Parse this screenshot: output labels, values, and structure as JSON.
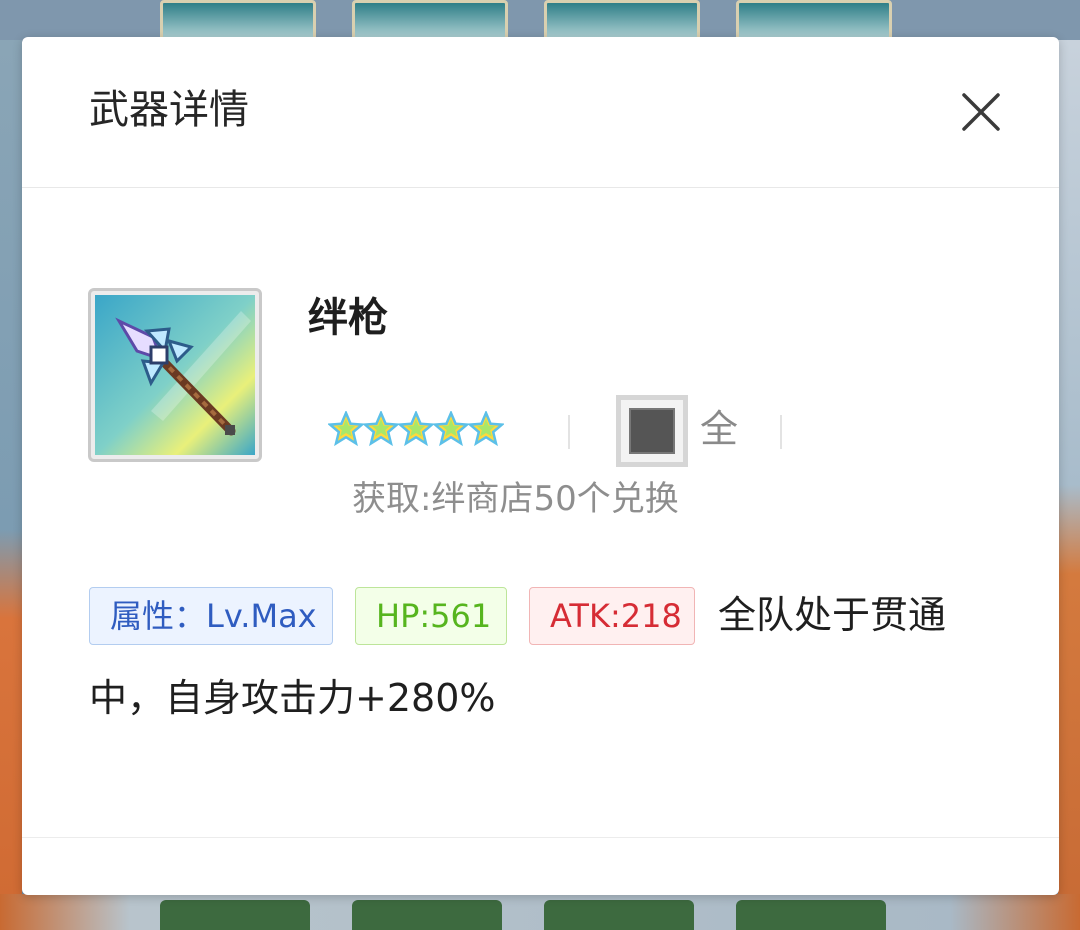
{
  "dialog": {
    "title": "武器详情",
    "close_icon": "close-icon"
  },
  "weapon": {
    "name": "绊枪",
    "icon": "spear-icon",
    "rarity_stars": 5,
    "element_label": "全",
    "source": "获取:绊商店50个兑换"
  },
  "tags": {
    "attribute": "属性：Lv.Max",
    "hp": "HP:561",
    "atk": "ATK:218"
  },
  "description": {
    "line1": "全队处于贯通",
    "line2": "中，自身攻击力+280%"
  },
  "colors": {
    "attribute_tag": "#2f5cc0",
    "hp_tag": "#56b51e",
    "atk_tag": "#d62c35"
  }
}
